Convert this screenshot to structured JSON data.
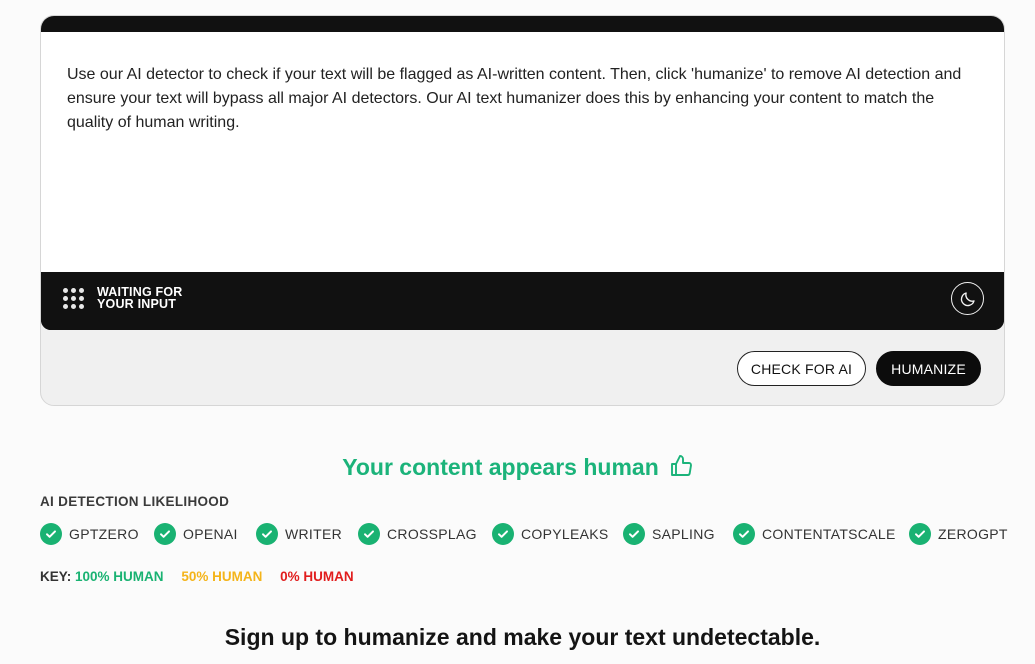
{
  "editor": {
    "text": "Use our AI detector to check if your text will be flagged as AI-written content. Then, click 'humanize' to remove AI detection and ensure your text will bypass all major AI detectors. Our AI text humanizer does this by enhancing your content to match the quality of human writing.",
    "status_line1": "WAITING FOR",
    "status_line2": "YOUR INPUT",
    "theme_icon": "moon-icon"
  },
  "actions": {
    "check_label": "CHECK FOR AI",
    "humanize_label": "HUMANIZE"
  },
  "result": {
    "headline": "Your content appears human",
    "icon": "thumbs-up-icon",
    "color": "#1bb37a"
  },
  "likelihood": {
    "title": "AI DETECTION LIKELIHOOD",
    "detectors": [
      "GPTZERO",
      "OPENAI",
      "WRITER",
      "CROSSPLAG",
      "COPYLEAKS",
      "SAPLING",
      "CONTENTATSCALE",
      "ZEROGPT"
    ],
    "check_color": "#19b272"
  },
  "key": {
    "label": "KEY:",
    "items": [
      "100% HUMAN",
      "50% HUMAN",
      "0% HUMAN"
    ],
    "colors": [
      "#19b272",
      "#f4b41a",
      "#e11d1d"
    ]
  },
  "signup": {
    "text": "Sign up to humanize and make your text undetectable."
  }
}
